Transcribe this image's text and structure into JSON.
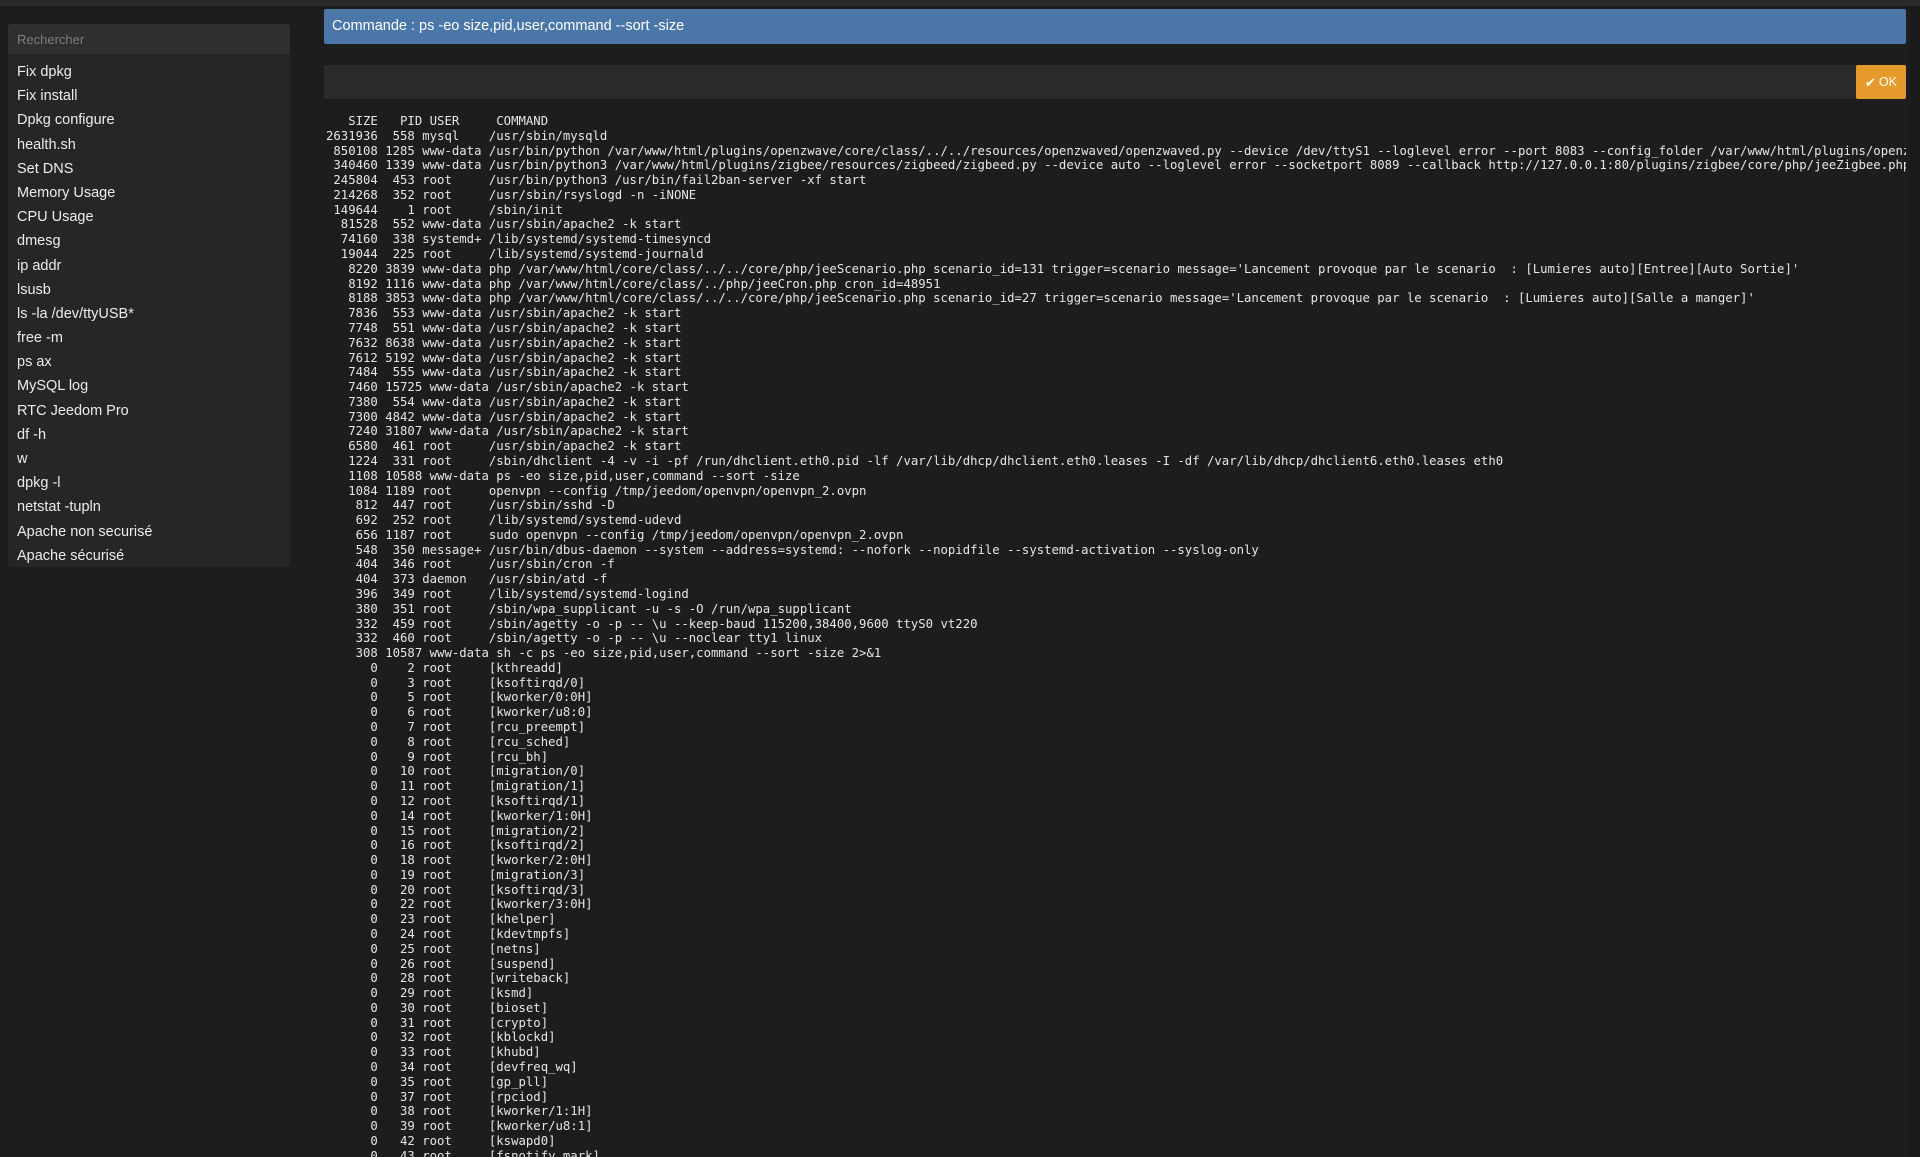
{
  "sidebar": {
    "search_placeholder": "Rechercher",
    "items": [
      {
        "label": "Fix dpkg"
      },
      {
        "label": "Fix install"
      },
      {
        "label": "Dpkg configure"
      },
      {
        "label": "health.sh"
      },
      {
        "label": "Set DNS"
      },
      {
        "label": "Memory Usage"
      },
      {
        "label": "CPU Usage"
      },
      {
        "label": "dmesg"
      },
      {
        "label": "ip addr"
      },
      {
        "label": "lsusb"
      },
      {
        "label": "ls -la /dev/ttyUSB*"
      },
      {
        "label": "free -m"
      },
      {
        "label": "ps ax"
      },
      {
        "label": "MySQL log"
      },
      {
        "label": "RTC Jeedom Pro"
      },
      {
        "label": "df -h"
      },
      {
        "label": "w"
      },
      {
        "label": "dpkg -l"
      },
      {
        "label": "netstat -tupln"
      },
      {
        "label": "Apache non securisé"
      },
      {
        "label": "Apache sécurisé"
      }
    ]
  },
  "command": {
    "title": "Commande : ps -eo size,pid,user,command --sort -size",
    "input_value": "",
    "ok_label": "OK",
    "ok_icon": "check-icon"
  },
  "output": {
    "text": "   SIZE   PID USER     COMMAND\n2631936  558 mysql    /usr/sbin/mysqld\n 850108 1285 www-data /usr/bin/python /var/www/html/plugins/openzwave/core/class/../../resources/openzwaved/openzwaved.py --device /dev/ttyS1 --loglevel error --port 8083 --config_folder /var/www/html/plugins/openzwave/resources/openzwaved/config\n 340460 1339 www-data /usr/bin/python3 /var/www/html/plugins/zigbee/resources/zigbeed/zigbeed.py --device auto --loglevel error --socketport 8089 --callback http://127.0.0.1:80/plugins/zigbee/core/php/jeeZigbee.php\n 245804  453 root     /usr/bin/python3 /usr/bin/fail2ban-server -xf start\n 214268  352 root     /usr/sbin/rsyslogd -n -iNONE\n 149644    1 root     /sbin/init\n  81528  552 www-data /usr/sbin/apache2 -k start\n  74160  338 systemd+ /lib/systemd/systemd-timesyncd\n  19044  225 root     /lib/systemd/systemd-journald\n   8220 3839 www-data php /var/www/html/core/class/../../core/php/jeeScenario.php scenario_id=131 trigger=scenario message='Lancement provoque par le scenario  : [Lumieres auto][Entree][Auto Sortie]'\n   8192 1116 www-data php /var/www/html/core/class/../php/jeeCron.php cron_id=48951\n   8188 3853 www-data php /var/www/html/core/class/../../core/php/jeeScenario.php scenario_id=27 trigger=scenario message='Lancement provoque par le scenario  : [Lumieres auto][Salle a manger]'\n   7836  553 www-data /usr/sbin/apache2 -k start\n   7748  551 www-data /usr/sbin/apache2 -k start\n   7632 8638 www-data /usr/sbin/apache2 -k start\n   7612 5192 www-data /usr/sbin/apache2 -k start\n   7484  555 www-data /usr/sbin/apache2 -k start\n   7460 15725 www-data /usr/sbin/apache2 -k start\n   7380  554 www-data /usr/sbin/apache2 -k start\n   7300 4842 www-data /usr/sbin/apache2 -k start\n   7240 31807 www-data /usr/sbin/apache2 -k start\n   6580  461 root     /usr/sbin/apache2 -k start\n   1224  331 root     /sbin/dhclient -4 -v -i -pf /run/dhclient.eth0.pid -lf /var/lib/dhcp/dhclient.eth0.leases -I -df /var/lib/dhcp/dhclient6.eth0.leases eth0\n   1108 10588 www-data ps -eo size,pid,user,command --sort -size\n   1084 1189 root     openvpn --config /tmp/jeedom/openvpn/openvpn_2.ovpn\n    812  447 root     /usr/sbin/sshd -D\n    692  252 root     /lib/systemd/systemd-udevd\n    656 1187 root     sudo openvpn --config /tmp/jeedom/openvpn/openvpn_2.ovpn\n    548  350 message+ /usr/bin/dbus-daemon --system --address=systemd: --nofork --nopidfile --systemd-activation --syslog-only\n    404  346 root     /usr/sbin/cron -f\n    404  373 daemon   /usr/sbin/atd -f\n    396  349 root     /lib/systemd/systemd-logind\n    380  351 root     /sbin/wpa_supplicant -u -s -O /run/wpa_supplicant\n    332  459 root     /sbin/agetty -o -p -- \\u --keep-baud 115200,38400,9600 ttyS0 vt220\n    332  460 root     /sbin/agetty -o -p -- \\u --noclear tty1 linux\n    308 10587 www-data sh -c ps -eo size,pid,user,command --sort -size 2>&1\n      0    2 root     [kthreadd]\n      0    3 root     [ksoftirqd/0]\n      0    5 root     [kworker/0:0H]\n      0    6 root     [kworker/u8:0]\n      0    7 root     [rcu_preempt]\n      0    8 root     [rcu_sched]\n      0    9 root     [rcu_bh]\n      0   10 root     [migration/0]\n      0   11 root     [migration/1]\n      0   12 root     [ksoftirqd/1]\n      0   14 root     [kworker/1:0H]\n      0   15 root     [migration/2]\n      0   16 root     [ksoftirqd/2]\n      0   18 root     [kworker/2:0H]\n      0   19 root     [migration/3]\n      0   20 root     [ksoftirqd/3]\n      0   22 root     [kworker/3:0H]\n      0   23 root     [khelper]\n      0   24 root     [kdevtmpfs]\n      0   25 root     [netns]\n      0   26 root     [suspend]\n      0   28 root     [writeback]\n      0   29 root     [ksmd]\n      0   30 root     [bioset]\n      0   31 root     [crypto]\n      0   32 root     [kblockd]\n      0   33 root     [khubd]\n      0   34 root     [devfreq_wq]\n      0   35 root     [gp_pll]\n      0   37 root     [rpciod]\n      0   38 root     [kworker/1:1H]\n      0   39 root     [kworker/u8:1]\n      0   42 root     [kswapd0]\n      0   43 root     [fsnotify_mark]"
  },
  "colors": {
    "background": "#1d1d1d",
    "sidebar": "#262626",
    "command_bar": "#4a77a8",
    "ok_button": "#e59a2b"
  }
}
